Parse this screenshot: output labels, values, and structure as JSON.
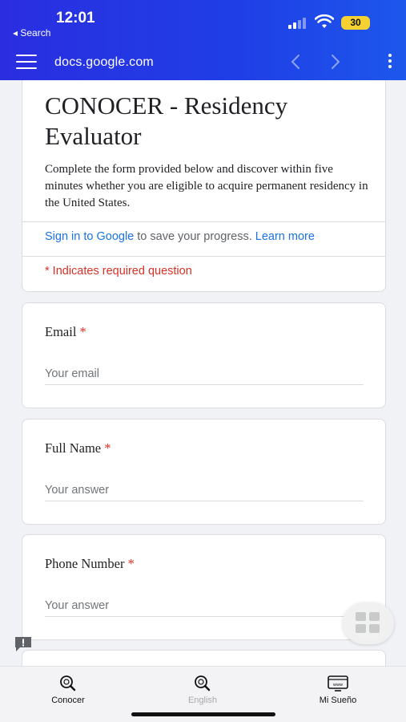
{
  "status_bar": {
    "time": "12:01",
    "back_label": "◂ Search",
    "battery": "30"
  },
  "browser": {
    "url": "docs.google.com"
  },
  "form": {
    "title": "CONOCER - Residency Evaluator",
    "description": "Complete the form provided below and discover within five minutes whether you are eligible to acquire permanent residency in the United States.",
    "signin_link": "Sign in to Google",
    "signin_text": " to save your progress. ",
    "learn_more": "Learn more",
    "required_note": "* Indicates required question",
    "required_star": "*",
    "questions": [
      {
        "title": "Email",
        "placeholder": "Your email"
      },
      {
        "title": "Full Name",
        "placeholder": "Your answer"
      },
      {
        "title": "Phone Number",
        "placeholder": "Your answer"
      }
    ]
  },
  "tabbar": {
    "tabs": [
      {
        "label": "Conocer",
        "icon": "search-icon",
        "active": true
      },
      {
        "label": "English",
        "icon": "search-icon",
        "active": false
      },
      {
        "label": "Mi Sueño",
        "icon": "browser-icon",
        "active": true
      }
    ]
  },
  "colors": {
    "brand_blue": "#2a2ee0",
    "link": "#1a73e8",
    "required": "#d93025"
  }
}
